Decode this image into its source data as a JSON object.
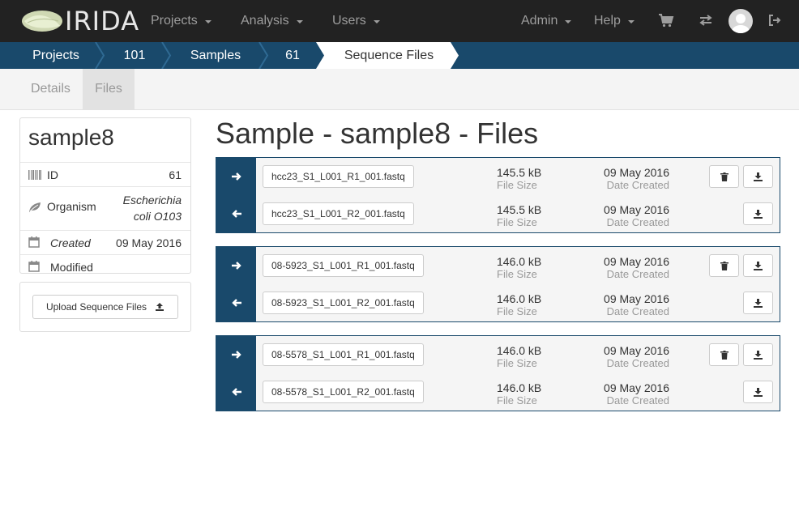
{
  "navbar": {
    "brand": "IRIDA",
    "menus": [
      {
        "label": "Projects"
      },
      {
        "label": "Analysis"
      },
      {
        "label": "Users"
      },
      {
        "label": "Admin"
      },
      {
        "label": "Help"
      }
    ],
    "icons": [
      "cart-icon",
      "exchange-icon",
      "avatar",
      "sign-out-icon"
    ]
  },
  "breadcrumb": [
    "Projects",
    "101",
    "Samples",
    "61",
    "Sequence Files"
  ],
  "tabs": [
    {
      "label": "Details",
      "active": false
    },
    {
      "label": "Files",
      "active": true
    }
  ],
  "sidebar": {
    "sample_name": "sample8",
    "rows": [
      {
        "icon": "barcode-icon",
        "label": "ID",
        "value": "61"
      },
      {
        "icon": "leaf-icon",
        "label": "Organism",
        "value_line1": "Escherichia",
        "value_line2": "coli O103"
      },
      {
        "icon": "calendar-icon",
        "label": "Created",
        "value": "09 May 2016"
      },
      {
        "icon": "calendar-icon",
        "label": "Modified",
        "value": ""
      }
    ],
    "upload_label": "Upload Sequence Files"
  },
  "main": {
    "title": "Sample - sample8 - Files",
    "size_label": "File Size",
    "date_label": "Date Created",
    "pairs": [
      {
        "forward": {
          "file": "hcc23_S1_L001_R1_001.fastq",
          "size": "145.5 kB",
          "date": "09 May 2016"
        },
        "reverse": {
          "file": "hcc23_S1_L001_R2_001.fastq",
          "size": "145.5 kB",
          "date": "09 May 2016"
        }
      },
      {
        "forward": {
          "file": "08-5923_S1_L001_R1_001.fastq",
          "size": "146.0 kB",
          "date": "09 May 2016"
        },
        "reverse": {
          "file": "08-5923_S1_L001_R2_001.fastq",
          "size": "146.0 kB",
          "date": "09 May 2016"
        }
      },
      {
        "forward": {
          "file": "08-5578_S1_L001_R1_001.fastq",
          "size": "146.0 kB",
          "date": "09 May 2016"
        },
        "reverse": {
          "file": "08-5578_S1_L001_R2_001.fastq",
          "size": "146.0 kB",
          "date": "09 May 2016"
        }
      }
    ]
  },
  "colors": {
    "navbar_bg": "#222222",
    "breadcrumb_bg": "#19496b",
    "accent": "#19496b"
  }
}
